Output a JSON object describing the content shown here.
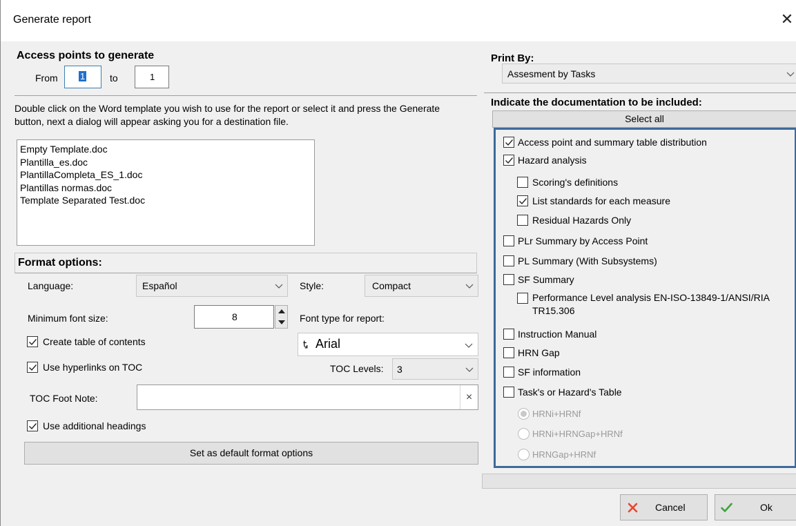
{
  "window": {
    "title": "Generate report",
    "close_glyph": "✕"
  },
  "access": {
    "heading": "Access points to generate",
    "from_label": "From",
    "from_value": "1",
    "to_label": "to",
    "to_value": "1"
  },
  "instructions": "Double click on the Word template you wish to use for the report or select it and press the Generate button, next a dialog will appear asking you for a destination file.",
  "templates": [
    "Empty Template.doc",
    "Plantilla_es.doc",
    "PlantillaCompleta_ES_1.doc",
    "Plantillas normas.doc",
    "Template Separated Test.doc"
  ],
  "format": {
    "heading": "Format options:",
    "language_label": "Language:",
    "language_value": "Español",
    "style_label": "Style:",
    "style_value": "Compact",
    "min_font_label": "Minimum font size:",
    "min_font_value": "8",
    "font_type_label": "Font type for report:",
    "font_type_value": "Arial",
    "font_icon": "Ꮏ",
    "create_toc_label": "Create table of contents",
    "create_toc_checked": true,
    "hyperlinks_label": "Use hyperlinks on TOC",
    "hyperlinks_checked": true,
    "toc_levels_label": "TOC Levels:",
    "toc_levels_value": "3",
    "toc_footnote_label": "TOC Foot Note:",
    "toc_footnote_value": "",
    "toc_footnote_clear": "×",
    "additional_headings_label": "Use additional headings",
    "additional_headings_checked": true,
    "set_default_button": "Set as default format options"
  },
  "print_by": {
    "label": "Print By:",
    "value": "Assesment by Tasks"
  },
  "documentation": {
    "heading": "Indicate the documentation to be included:",
    "select_all": "Select all",
    "items": [
      {
        "label": "Access point and summary table distribution",
        "checked": true
      },
      {
        "label": "Hazard analysis",
        "checked": true
      },
      {
        "label": "Scoring's definitions",
        "checked": false
      },
      {
        "label": "List standards for each measure",
        "checked": true
      },
      {
        "label": "Residual Hazards Only",
        "checked": false
      },
      {
        "label": "PLr Summary by Access Point",
        "checked": false
      },
      {
        "label": "PL Summary (With Subsystems)",
        "checked": false
      },
      {
        "label": "SF Summary",
        "checked": false
      },
      {
        "label": "Performance Level analysis EN-ISO-13849-1/ANSI/RIA",
        "label2": "TR15.306",
        "checked": false
      },
      {
        "label": "Instruction Manual",
        "checked": false
      },
      {
        "label": "HRN Gap",
        "checked": false
      },
      {
        "label": "SF information",
        "checked": false
      },
      {
        "label": "Task's or Hazard's Table",
        "checked": false
      }
    ],
    "radios": [
      {
        "label": "HRNi+HRNf",
        "selected": true
      },
      {
        "label": "HRNi+HRNGap+HRNf",
        "selected": false
      },
      {
        "label": "HRNGap+HRNf",
        "selected": false
      }
    ]
  },
  "footer": {
    "cancel": "Cancel",
    "ok": "Ok"
  },
  "colors": {
    "panel_border": "#3d6a9a",
    "cancel_icon": "#e8452c",
    "ok_icon": "#3aa53a"
  }
}
